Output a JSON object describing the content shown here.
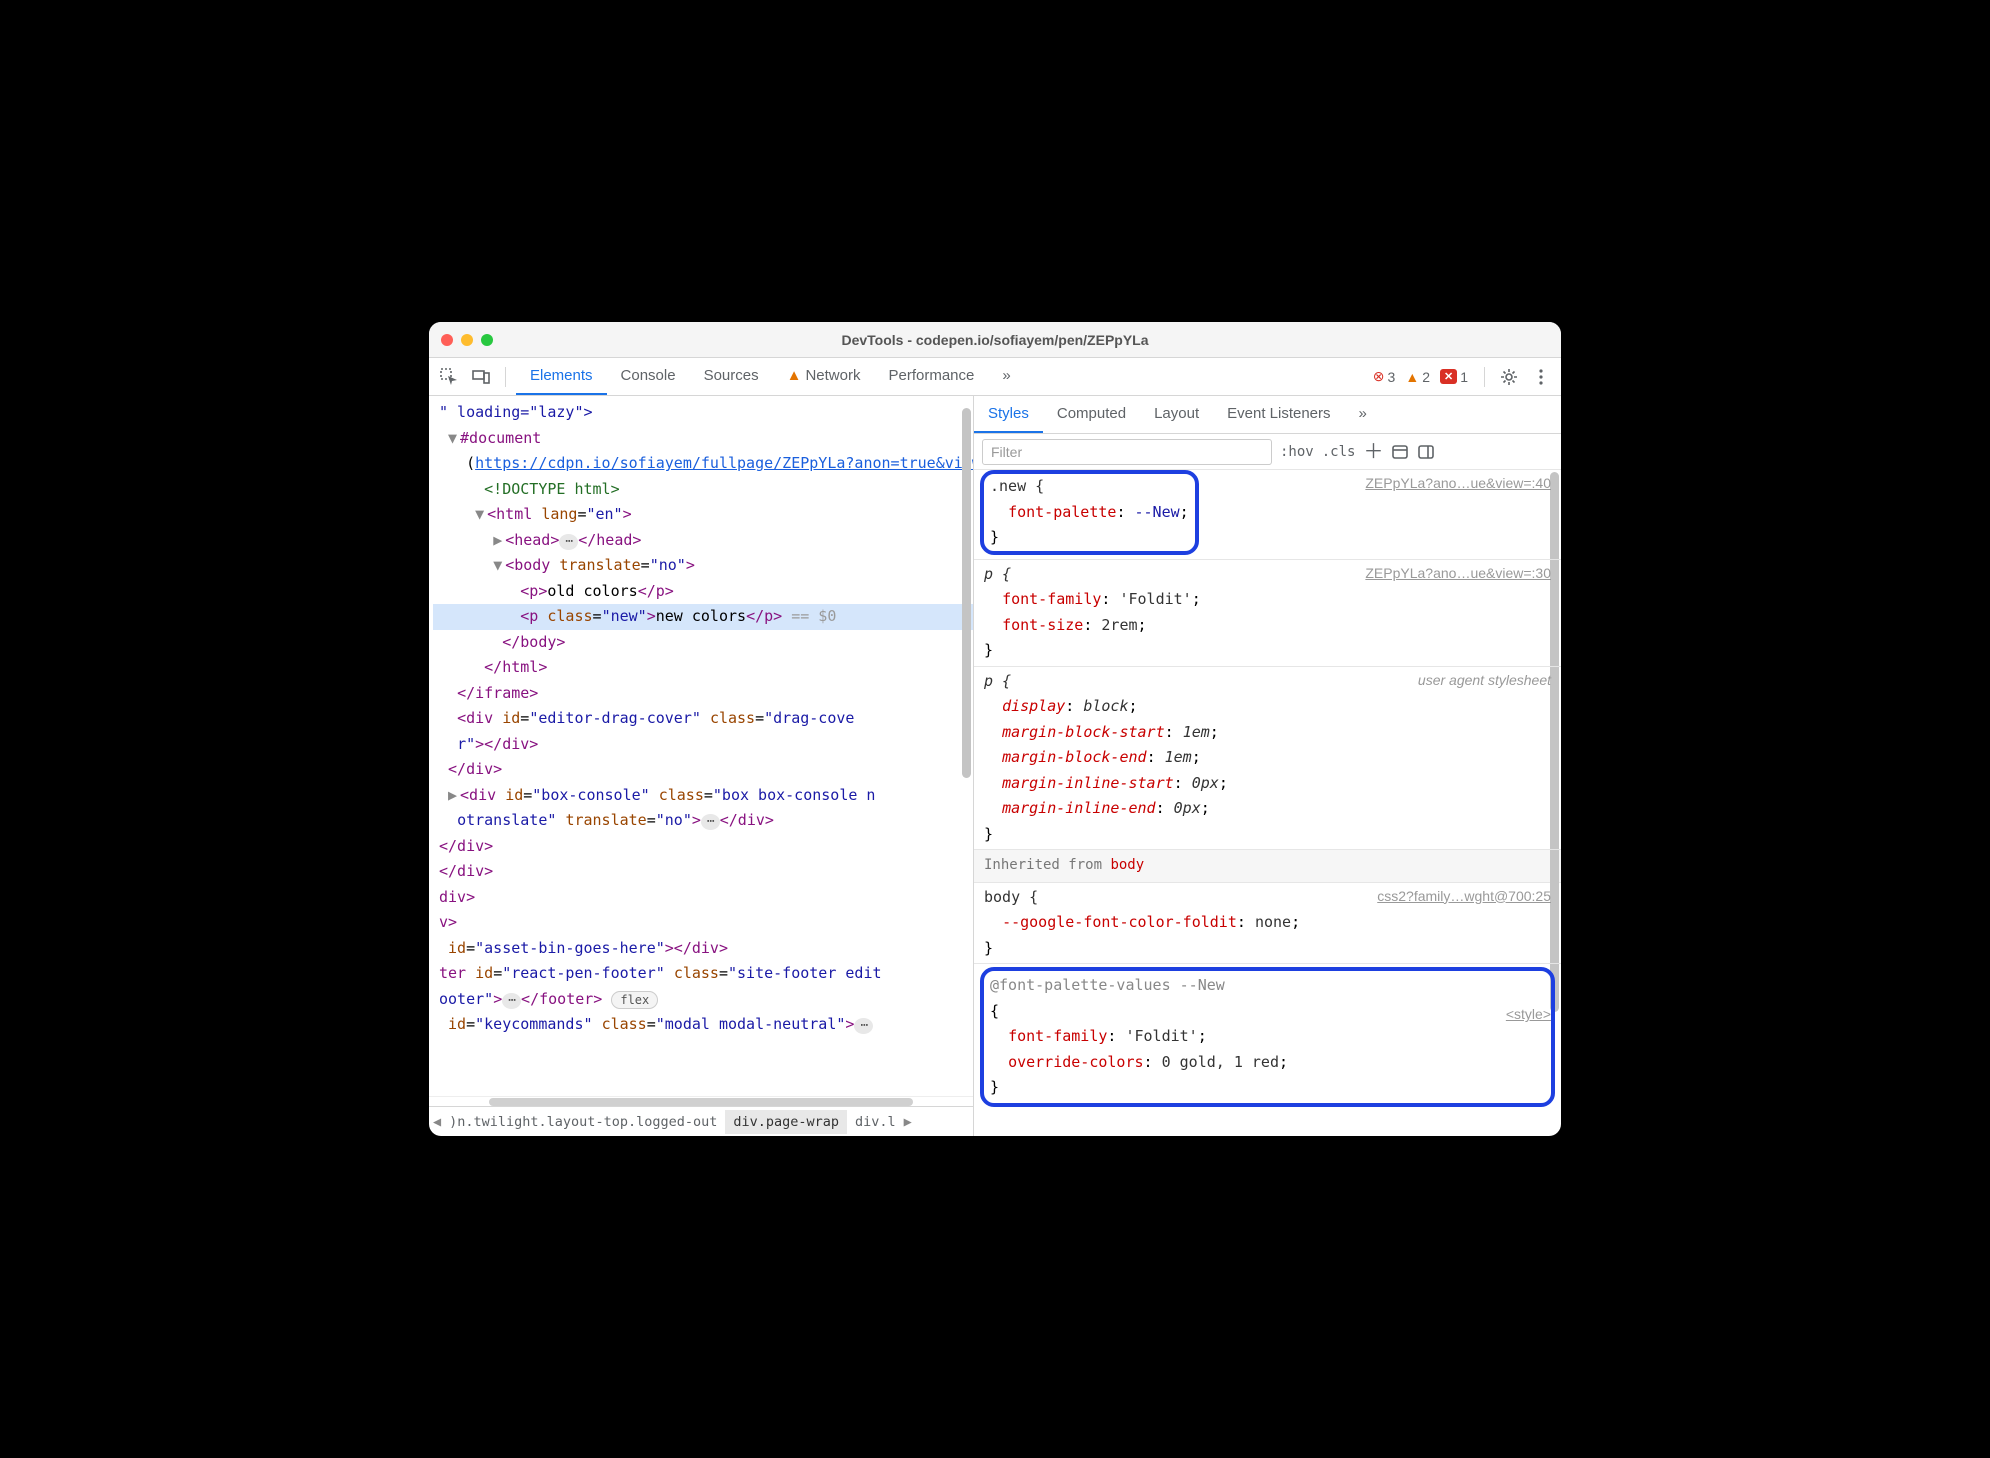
{
  "window_title": "DevTools - codepen.io/sofiayem/pen/ZEPpYLa",
  "top_tabs": {
    "elements": "Elements",
    "console": "Console",
    "sources": "Sources",
    "network": "Network",
    "performance": "Performance",
    "overflow": "»"
  },
  "counts": {
    "errors": "3",
    "warnings": "2",
    "messages": "1"
  },
  "dom": {
    "l1": "\" loading=\"lazy\">",
    "doc": "#document",
    "doc_open": "(",
    "doc_url": "https://cdpn.io/sofiayem/fullpage/ZEPpYLa?anon=true&view=",
    "doc_close": ")",
    "doctype": "<!DOCTYPE html>",
    "html_open": "<html lang=\"en\">",
    "head_open": "<head>",
    "head_close": "</head>",
    "body_open": "<body translate=\"no\">",
    "p1_open": "<p>",
    "p1_text": "old colors",
    "p1_close": "</p>",
    "p2_open": "<p class=\"new\">",
    "p2_text": "new colors",
    "p2_close": "</p>",
    "eq": "== $0",
    "body_close": "</body>",
    "html_close": "</html>",
    "iframe_close": "</iframe>",
    "drag_a": "<div id=\"editor-drag-cover\" class=\"drag-cove",
    "drag_b": "r\"></div>",
    "div_close": "</div>",
    "box_a": "<div id=\"box-console\" class=\"box box-console n",
    "box_b": "otranslate\" translate=\"no\">",
    "box_close": "</div>",
    "stray_div": "div>",
    "stray_v": "v>",
    "asset": " id=\"asset-bin-goes-here\"></div>",
    "footer_a": "ter id=\"react-pen-footer\" class=\"site-footer edit",
    "footer_b": "ooter\">",
    "footer_close": "</footer>",
    "flex_pill": "flex",
    "key": " id=\"keycommands\" class=\"modal modal-neutral\">"
  },
  "crumbs": {
    "c1": ")n.twilight.layout-top.logged-out",
    "c2": "div.page-wrap",
    "c3": "div.l"
  },
  "styles_tabs": {
    "styles": "Styles",
    "computed": "Computed",
    "layout": "Layout",
    "events": "Event Listeners",
    "overflow": "»"
  },
  "filter_placeholder": "Filter",
  "hov_label": ":hov",
  "cls_label": ".cls",
  "rules": {
    "r1": {
      "selector": ".new {",
      "origin": "ZEPpYLa?ano…ue&view=:40",
      "p1_name": "font-palette",
      "p1_val": "--New",
      "close": "}"
    },
    "r2": {
      "selector": "p {",
      "origin": "ZEPpYLa?ano…ue&view=:30",
      "p1_name": "font-family",
      "p1_val": "'Foldit'",
      "p2_name": "font-size",
      "p2_val": "2rem",
      "close": "}"
    },
    "r3": {
      "selector": "p {",
      "origin": "user agent stylesheet",
      "p1_name": "display",
      "p1_val": "block",
      "p2_name": "margin-block-start",
      "p2_val": "1em",
      "p3_name": "margin-block-end",
      "p3_val": "1em",
      "p4_name": "margin-inline-start",
      "p4_val": "0px",
      "p5_name": "margin-inline-end",
      "p5_val": "0px",
      "close": "}"
    },
    "inherit_label": "Inherited from ",
    "inherit_src": "body",
    "r4": {
      "selector": "body {",
      "origin": "css2?family…wght@700:25",
      "p1_name": "--google-font-color-foldit",
      "p1_val": "none",
      "close": "}"
    },
    "r5": {
      "selector": "@font-palette-values --New",
      "origin": "<style>",
      "open": "{",
      "p1_name": "font-family",
      "p1_val": "'Foldit'",
      "p2_name": "override-colors",
      "p2_val": "0 gold, 1 red",
      "close": "}"
    }
  }
}
